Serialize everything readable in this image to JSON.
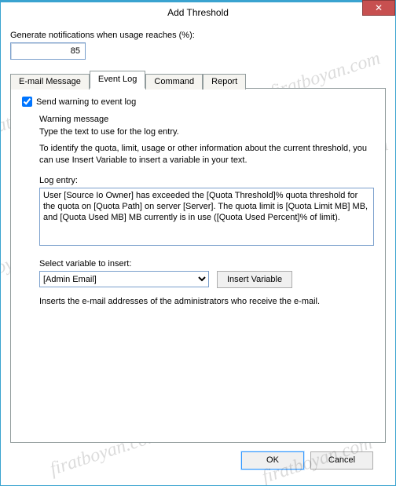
{
  "window": {
    "title": "Add Threshold"
  },
  "gen": {
    "label": "Generate notifications when usage reaches (%):",
    "value": "85"
  },
  "tabs": {
    "email": "E-mail Message",
    "eventlog": "Event Log",
    "command": "Command",
    "report": "Report"
  },
  "eventlog": {
    "checkbox_label": "Send warning to event log",
    "checked": true,
    "warning_title": "Warning message",
    "warning_desc": "Type the text to use for the log entry.",
    "warning_help": "To identify the quota, limit, usage or other information about the current threshold, you can use Insert Variable to insert a variable in your text.",
    "log_label": "Log entry:",
    "log_value": "User [Source Io Owner] has exceeded the [Quota Threshold]% quota threshold for the quota on [Quota Path] on server [Server]. The quota limit is [Quota Limit MB] MB, and [Quota Used MB] MB currently is in use ([Quota Used Percent]% of limit).",
    "select_label": "Select variable to insert:",
    "select_value": "[Admin Email]",
    "insert_button": "Insert Variable",
    "insert_help": "Inserts the e-mail addresses of the administrators who receive the e-mail."
  },
  "footer": {
    "ok": "OK",
    "cancel": "Cancel"
  },
  "watermark": "firatboyan.com"
}
